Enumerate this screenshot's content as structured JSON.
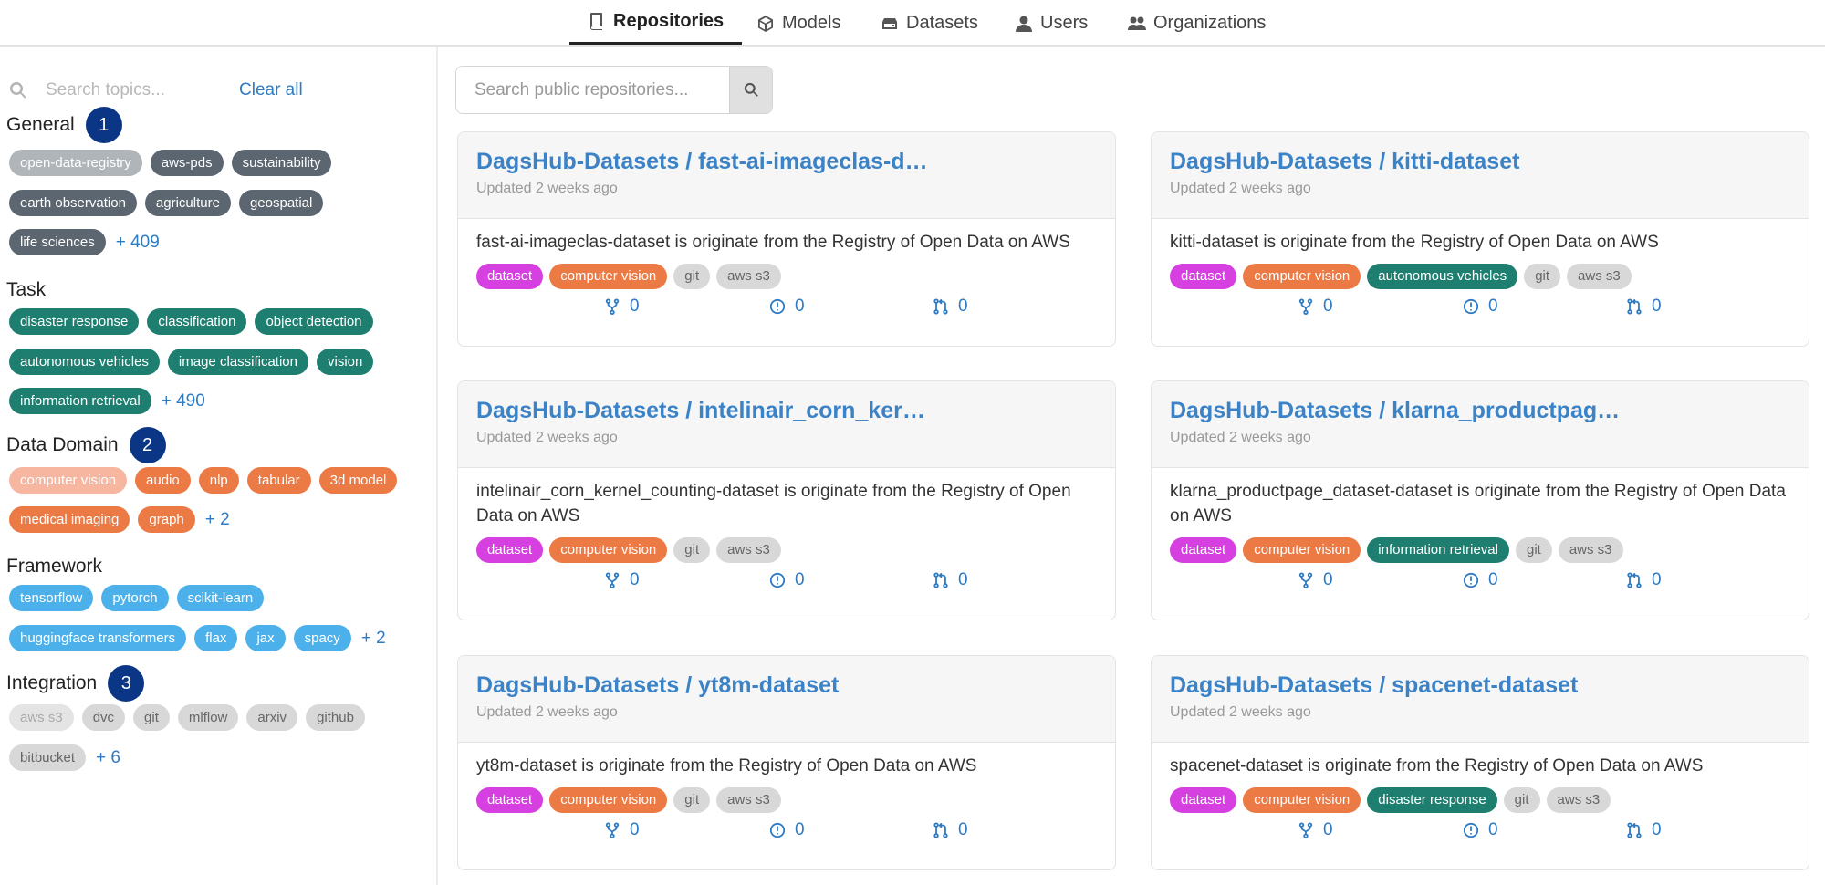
{
  "tabs": [
    {
      "label": "Repositories",
      "icon": "book-icon",
      "active": true
    },
    {
      "label": "Models",
      "icon": "cube-icon",
      "active": false
    },
    {
      "label": "Datasets",
      "icon": "database-icon",
      "active": false
    },
    {
      "label": "Users",
      "icon": "user-icon",
      "active": false
    },
    {
      "label": "Organizations",
      "icon": "users-icon",
      "active": false
    }
  ],
  "sidebar": {
    "search_placeholder": "Search topics...",
    "clear_all": "Clear all",
    "sections": [
      {
        "title": "General",
        "badge": "1",
        "rows": [
          [
            "open-data-registry",
            "aws-pds",
            "sustainability"
          ],
          [
            "earth observation",
            "agriculture",
            "geospatial"
          ],
          [
            "life sciences"
          ]
        ],
        "more": "+ 409"
      },
      {
        "title": "Task",
        "badge": "",
        "rows": [
          [
            "disaster response",
            "classification",
            "object detection"
          ],
          [
            "autonomous vehicles",
            "image classification",
            "vision"
          ],
          [
            "information retrieval"
          ]
        ],
        "more": "+ 490"
      },
      {
        "title": "Data Domain",
        "badge": "2",
        "rows": [
          [
            "computer vision",
            "audio",
            "nlp",
            "tabular",
            "3d model"
          ],
          [
            "medical imaging",
            "graph"
          ]
        ],
        "more": "+ 2"
      },
      {
        "title": "Framework",
        "badge": "",
        "rows": [
          [
            "tensorflow",
            "pytorch",
            "scikit-learn"
          ],
          [
            "huggingface transformers",
            "flax",
            "jax",
            "spacy"
          ]
        ],
        "more": "+ 2"
      },
      {
        "title": "Integration",
        "badge": "3",
        "rows": [
          [
            "aws s3",
            "dvc",
            "git",
            "mlflow",
            "arxiv",
            "github"
          ],
          [
            "bitbucket"
          ]
        ],
        "more": "+ 6"
      }
    ]
  },
  "search": {
    "placeholder": "Search public repositories..."
  },
  "cards": [
    {
      "title": "DagsHub-Datasets / fast-ai-imageclas-d…",
      "updated": "Updated 2 weeks ago",
      "desc": "fast-ai-imageclas-dataset is originate from the Registry of Open Data on AWS",
      "tags": [
        "dataset",
        "computer vision",
        "git",
        "aws s3"
      ],
      "forks": "0",
      "issues": "0",
      "prs": "0"
    },
    {
      "title": "DagsHub-Datasets / kitti-dataset",
      "updated": "Updated 2 weeks ago",
      "desc": "kitti-dataset is originate from the Registry of Open Data on AWS",
      "tags": [
        "dataset",
        "computer vision",
        "autonomous vehicles",
        "git",
        "aws s3"
      ],
      "forks": "0",
      "issues": "0",
      "prs": "0"
    },
    {
      "title": "DagsHub-Datasets / intelinair_corn_ker…",
      "updated": "Updated 2 weeks ago",
      "desc": "intelinair_corn_kernel_counting-dataset is originate from the Registry of Open Data on AWS",
      "tags": [
        "dataset",
        "computer vision",
        "git",
        "aws s3"
      ],
      "forks": "0",
      "issues": "0",
      "prs": "0"
    },
    {
      "title": "DagsHub-Datasets / klarna_productpag…",
      "updated": "Updated 2 weeks ago",
      "desc": "klarna_productpage_dataset-dataset is originate from the Registry of Open Data on AWS",
      "tags": [
        "dataset",
        "computer vision",
        "information retrieval",
        "git",
        "aws s3"
      ],
      "forks": "0",
      "issues": "0",
      "prs": "0"
    },
    {
      "title": "DagsHub-Datasets / yt8m-dataset",
      "updated": "Updated 2 weeks ago",
      "desc": "yt8m-dataset is originate from the Registry of Open Data on AWS",
      "tags": [
        "dataset",
        "computer vision",
        "git",
        "aws s3"
      ],
      "forks": "0",
      "issues": "0",
      "prs": "0"
    },
    {
      "title": "DagsHub-Datasets / spacenet-dataset",
      "updated": "Updated 2 weeks ago",
      "desc": "spacenet-dataset is originate from the Registry of Open Data on AWS",
      "tags": [
        "dataset",
        "computer vision",
        "disaster response",
        "git",
        "aws s3"
      ],
      "forks": "0",
      "issues": "0",
      "prs": "0"
    }
  ]
}
